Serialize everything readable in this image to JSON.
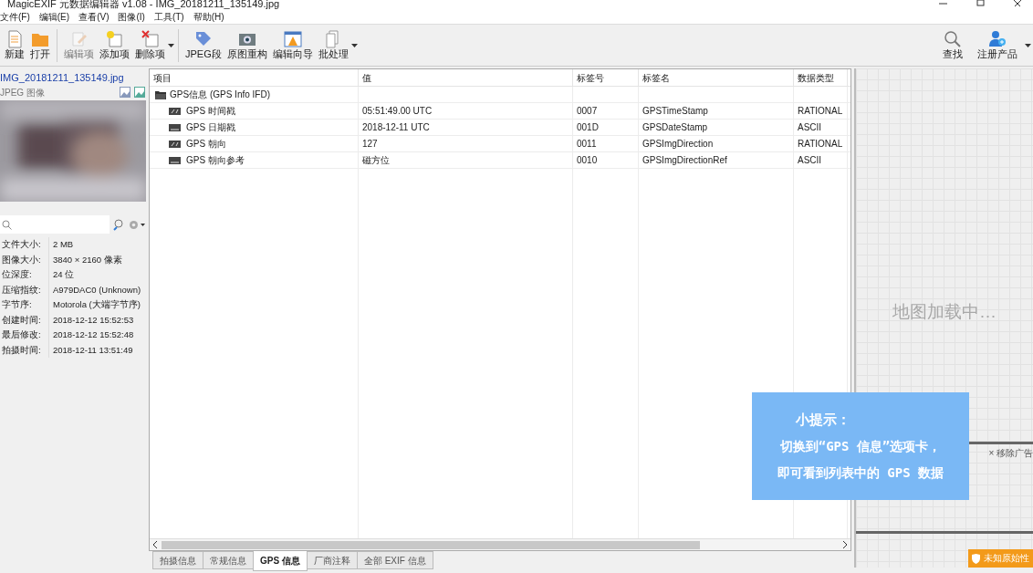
{
  "window": {
    "title": "MagicEXIF 元数据编辑器 v1.08 - IMG_20181211_135149.jpg"
  },
  "menu": [
    "文件(F)",
    "编辑(E)",
    "查看(V)",
    "图像(I)",
    "工具(T)",
    "帮助(H)"
  ],
  "toolbar": [
    {
      "kind": "button",
      "label": "新建",
      "disabled": false
    },
    {
      "kind": "button",
      "label": "打开",
      "disabled": false
    },
    {
      "kind": "sep"
    },
    {
      "kind": "button",
      "label": "编辑项",
      "disabled": true
    },
    {
      "kind": "button",
      "label": "添加项",
      "disabled": false
    },
    {
      "kind": "button",
      "label": "删除项",
      "disabled": false,
      "dropdown": true
    },
    {
      "kind": "sep"
    },
    {
      "kind": "button",
      "label": "JPEG段",
      "disabled": false
    },
    {
      "kind": "button",
      "label": "原图重构",
      "disabled": false
    },
    {
      "kind": "button",
      "label": "编辑向导",
      "disabled": false
    },
    {
      "kind": "button",
      "label": "批处理",
      "disabled": false,
      "dropdown": true
    }
  ],
  "toolbar_right": [
    {
      "label": "查找"
    },
    {
      "label": "注册产品"
    }
  ],
  "sidebar": {
    "filename": "IMG_20181211_135149.jpg",
    "filetype": "JPEG 图像",
    "info": [
      {
        "label": "文件大小:",
        "value": "2 MB"
      },
      {
        "label": "图像大小:",
        "value": "3840 × 2160 像素"
      },
      {
        "label": "位深度:",
        "value": "24 位"
      },
      {
        "label": "压缩指纹:",
        "value": "A979DAC0 (Unknown)"
      },
      {
        "label": "字节序:",
        "value": "Motorola (大端字节序)"
      },
      {
        "label": "创建时间:",
        "value": "2018-12-12 15:52:53"
      },
      {
        "label": "最后修改:",
        "value": "2018-12-12 15:52:48"
      },
      {
        "label": "拍摄时间:",
        "value": "2018-12-11 13:51:49"
      }
    ]
  },
  "table": {
    "columns": [
      "项目",
      "值",
      "标签号",
      "标签名",
      "数据类型"
    ],
    "group": {
      "label": "GPS信息 (GPS Info IFD)",
      "expanded": true,
      "children": [
        {
          "kind": "rational",
          "cells": [
            "GPS 时间戳",
            "05:51:49.00 UTC",
            "0007",
            "GPSTimeStamp",
            "RATIONAL"
          ]
        },
        {
          "kind": "ascii",
          "cells": [
            "GPS 日期戳",
            "2018-12-11 UTC",
            "001D",
            "GPSDateStamp",
            "ASCII"
          ]
        },
        {
          "kind": "rational",
          "cells": [
            "GPS 朝向",
            "127",
            "0011",
            "GPSImgDirection",
            "RATIONAL"
          ]
        },
        {
          "kind": "ascii",
          "cells": [
            "GPS 朝向参考",
            "磁方位",
            "0010",
            "GPSImgDirectionRef",
            "ASCII"
          ]
        }
      ]
    }
  },
  "tabs": [
    {
      "label": "拍摄信息",
      "selected": false
    },
    {
      "label": "常规信息",
      "selected": false
    },
    {
      "label": "GPS 信息",
      "selected": true
    },
    {
      "label": "厂商注释",
      "selected": false
    },
    {
      "label": "全部 EXIF 信息",
      "selected": false
    }
  ],
  "map": {
    "loading": "地图加载中…",
    "remove_ad": "× 移除广告",
    "badge": "未知原始性"
  },
  "tip": {
    "title": "小提示：",
    "lines": [
      "切换到“GPS 信息”选项卡，",
      "即可看到列表中的 GPS 数据"
    ]
  }
}
